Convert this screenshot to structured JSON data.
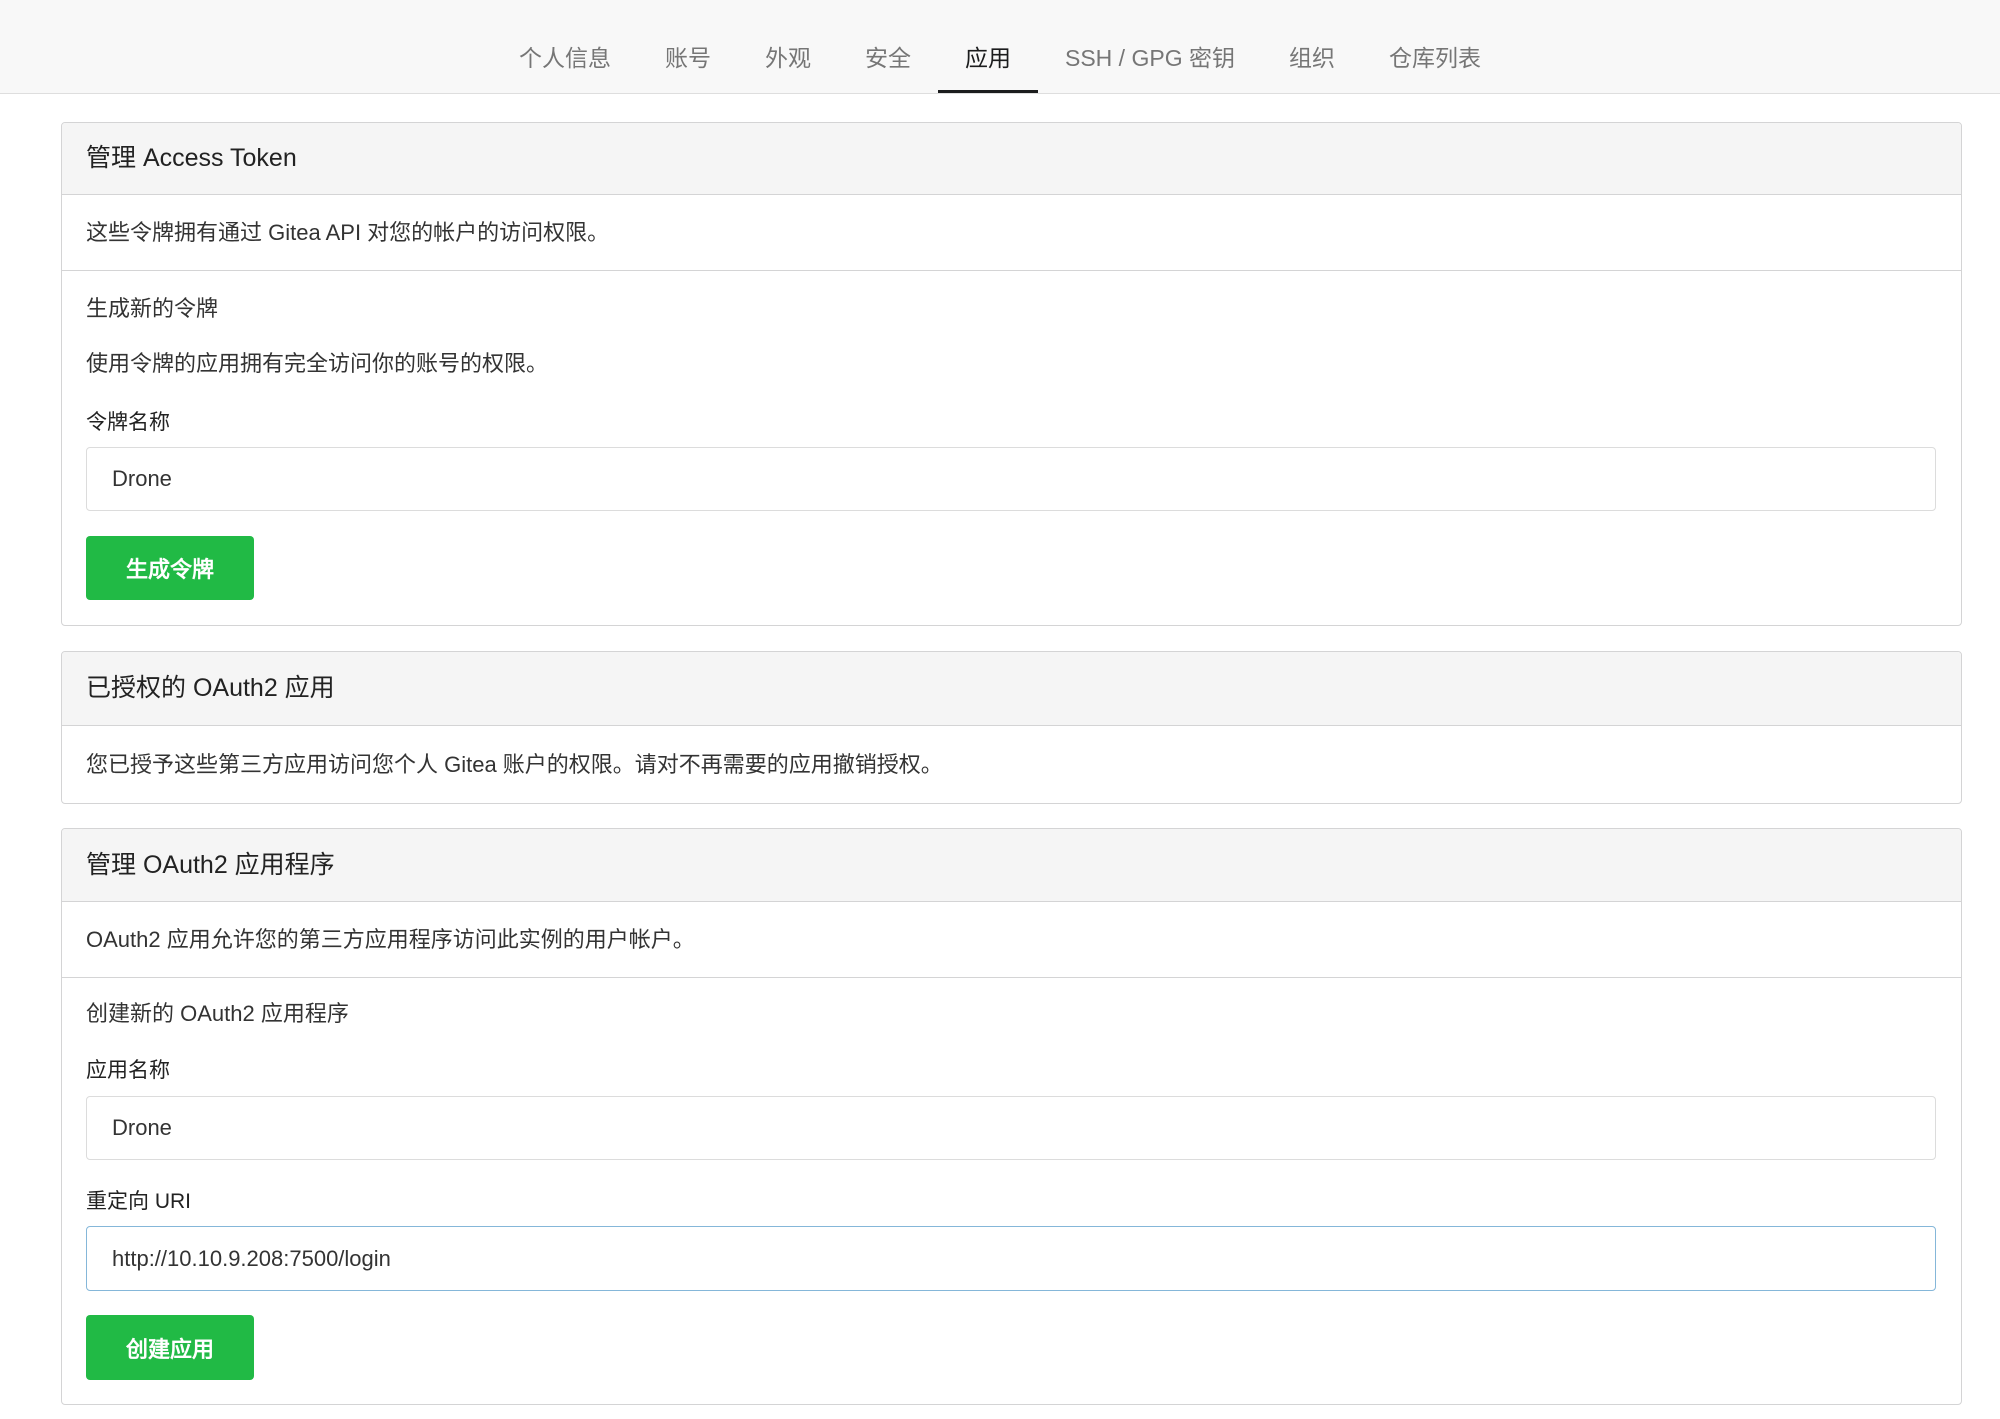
{
  "nav": {
    "tabs": [
      {
        "label": "个人信息",
        "active": false
      },
      {
        "label": "账号",
        "active": false
      },
      {
        "label": "外观",
        "active": false
      },
      {
        "label": "安全",
        "active": false
      },
      {
        "label": "应用",
        "active": true
      },
      {
        "label": "SSH / GPG 密钥",
        "active": false
      },
      {
        "label": "组织",
        "active": false
      },
      {
        "label": "仓库列表",
        "active": false
      }
    ]
  },
  "access_token": {
    "title": "管理 Access Token",
    "description": "这些令牌拥有通过 Gitea API 对您的帐户的访问权限。",
    "generate_heading": "生成新的令牌",
    "generate_note": "使用令牌的应用拥有完全访问你的账号的权限。",
    "name_label": "令牌名称",
    "name_value": "Drone",
    "button_label": "生成令牌"
  },
  "authorized_oauth2": {
    "title": "已授权的 OAuth2 应用",
    "description": "您已授予这些第三方应用访问您个人 Gitea 账户的权限。请对不再需要的应用撤销授权。"
  },
  "manage_oauth2": {
    "title": "管理 OAuth2 应用程序",
    "description": "OAuth2 应用允许您的第三方应用程序访问此实例的用户帐户。",
    "create_heading": "创建新的 OAuth2 应用程序",
    "app_name_label": "应用名称",
    "app_name_value": "Drone",
    "redirect_label": "重定向 URI",
    "redirect_value": "http://10.10.9.208:7500/login",
    "button_label": "创建应用"
  },
  "colors": {
    "button_green": "#21ba45",
    "focus_border": "#85b7d9",
    "active_tab": "#1b1c1d"
  }
}
